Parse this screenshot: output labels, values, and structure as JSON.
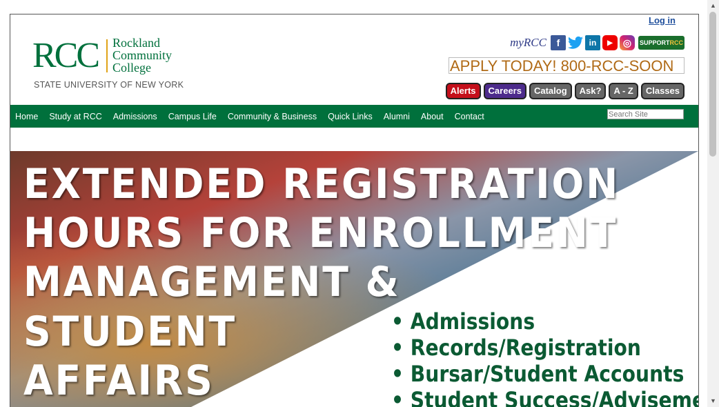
{
  "header": {
    "login_label": "Log in",
    "logo": {
      "initials": "RCC",
      "name_line1": "Rockland",
      "name_line2": "Community",
      "name_line3": "College",
      "system": "STATE UNIVERSITY OF NEW YORK"
    },
    "social": {
      "myrcc_label": "myRCC",
      "facebook_icon": "f",
      "twitter_icon": "🐦",
      "linkedin_icon": "in",
      "youtube_icon": "▶",
      "instagram_icon": "◎",
      "support_prefix": "SUPPORT",
      "support_suffix": "RCC"
    },
    "apply_text": "APPLY TODAY! 800-RCC-SOON",
    "quick_buttons": [
      "Alerts",
      "Careers",
      "Catalog",
      "Ask?",
      "A - Z",
      "Classes"
    ]
  },
  "nav": {
    "items": [
      "Home",
      "Study at RCC",
      "Admissions",
      "Campus Life",
      "Community & Business",
      "Quick Links",
      "Alumni",
      "About",
      "Contact"
    ],
    "search_placeholder": "Search Site"
  },
  "banner": {
    "headline_lines": [
      "EXTENDED REGISTRATION",
      "HOURS FOR ENROLLMENT",
      "MANAGEMENT &",
      "STUDENT",
      "AFFAIRS"
    ],
    "bullets": [
      "• Admissions",
      "• Records/Registration",
      "• Bursar/Student Accounts",
      "• Student Success/Advisement"
    ]
  },
  "colors": {
    "brand_green": "#00703c",
    "apply_orange": "#b06a16",
    "alerts_red": "#c50f1b",
    "careers_purple": "#4d2b8c"
  }
}
